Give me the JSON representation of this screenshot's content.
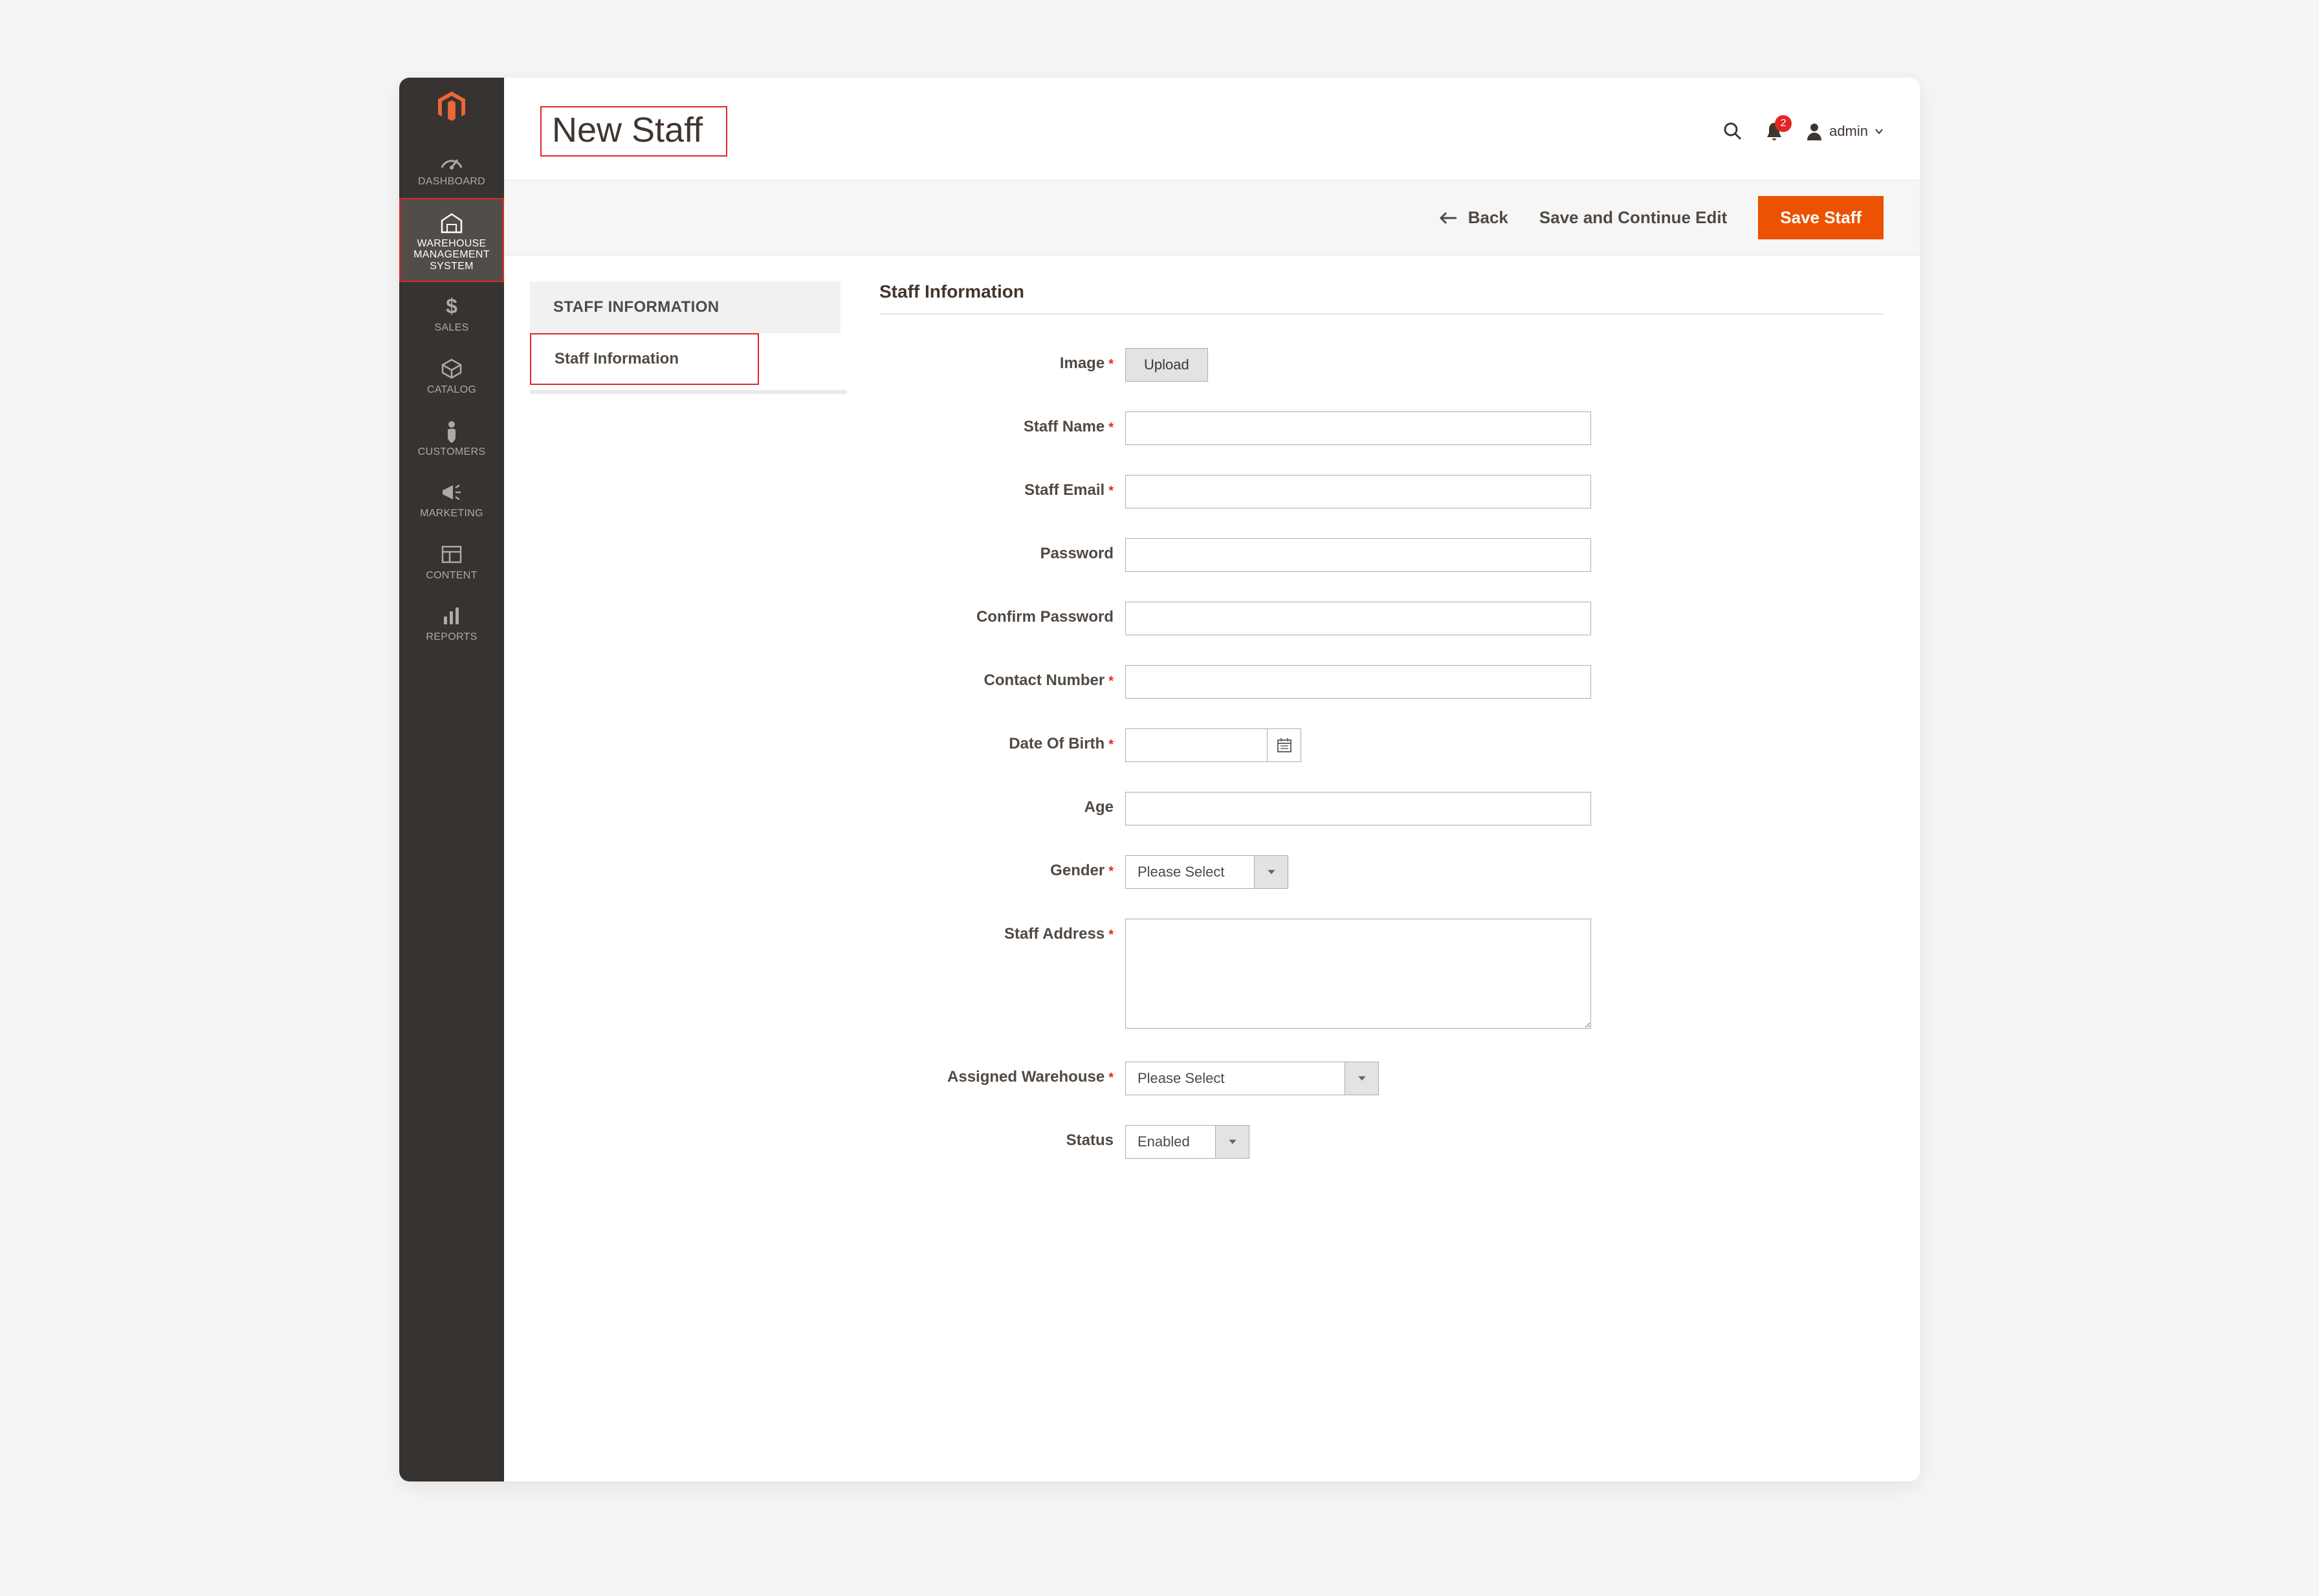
{
  "header": {
    "title": "New Staff",
    "username": "admin",
    "notification_count": "2"
  },
  "actions": {
    "back": "Back",
    "save_continue": "Save and Continue Edit",
    "save": "Save Staff"
  },
  "sidebar": {
    "items": [
      {
        "label": "DASHBOARD"
      },
      {
        "label": "WAREHOUSE MANAGEMENT SYSTEM"
      },
      {
        "label": "SALES"
      },
      {
        "label": "CATALOG"
      },
      {
        "label": "CUSTOMERS"
      },
      {
        "label": "MARKETING"
      },
      {
        "label": "CONTENT"
      },
      {
        "label": "REPORTS"
      }
    ]
  },
  "panel": {
    "header": "STAFF INFORMATION",
    "tab": "Staff Information"
  },
  "form": {
    "section_title": "Staff Information",
    "fields": {
      "image": {
        "label": "Image",
        "button": "Upload"
      },
      "staff_name": {
        "label": "Staff Name"
      },
      "staff_email": {
        "label": "Staff Email"
      },
      "password": {
        "label": "Password"
      },
      "confirm_password": {
        "label": "Confirm Password"
      },
      "contact_number": {
        "label": "Contact Number"
      },
      "dob": {
        "label": "Date Of Birth"
      },
      "age": {
        "label": "Age"
      },
      "gender": {
        "label": "Gender",
        "value": "Please Select"
      },
      "staff_address": {
        "label": "Staff Address"
      },
      "assigned_warehouse": {
        "label": "Assigned Warehouse",
        "value": "Please Select"
      },
      "status": {
        "label": "Status",
        "value": "Enabled"
      }
    }
  }
}
